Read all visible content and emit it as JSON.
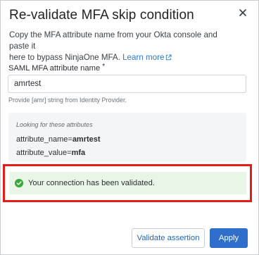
{
  "dialog": {
    "title": "Re-validate MFA skip condition",
    "description_line1": "Copy the MFA attribute name from your Okta console and paste it",
    "description_line2": "here to bypass NinjaOne MFA. ",
    "learn_more_link": "Learn more"
  },
  "field": {
    "label": "SAML MFA attribute name",
    "required_marker": "*",
    "value": "amrtest",
    "hint": "Provide [amr] string from Identity Provider."
  },
  "attributes": {
    "heading": "Looking for these attributes",
    "name_key": "attribute_name=",
    "name_value": "amrtest",
    "value_key": "attribute_value=",
    "value_value": "mfa"
  },
  "status": {
    "message": "Your connection has been validated.",
    "color": "#38a93c"
  },
  "buttons": {
    "validate_label": "Validate assertion",
    "apply_label": "Apply"
  },
  "icons": {
    "close": "close-icon",
    "external_link": "external-link-icon",
    "success": "check-circle-icon"
  },
  "colors": {
    "accent": "#2f6fcb",
    "link": "#2e78c7",
    "highlight_border": "#e21b1b",
    "success_bg": "#e9f5e7"
  }
}
